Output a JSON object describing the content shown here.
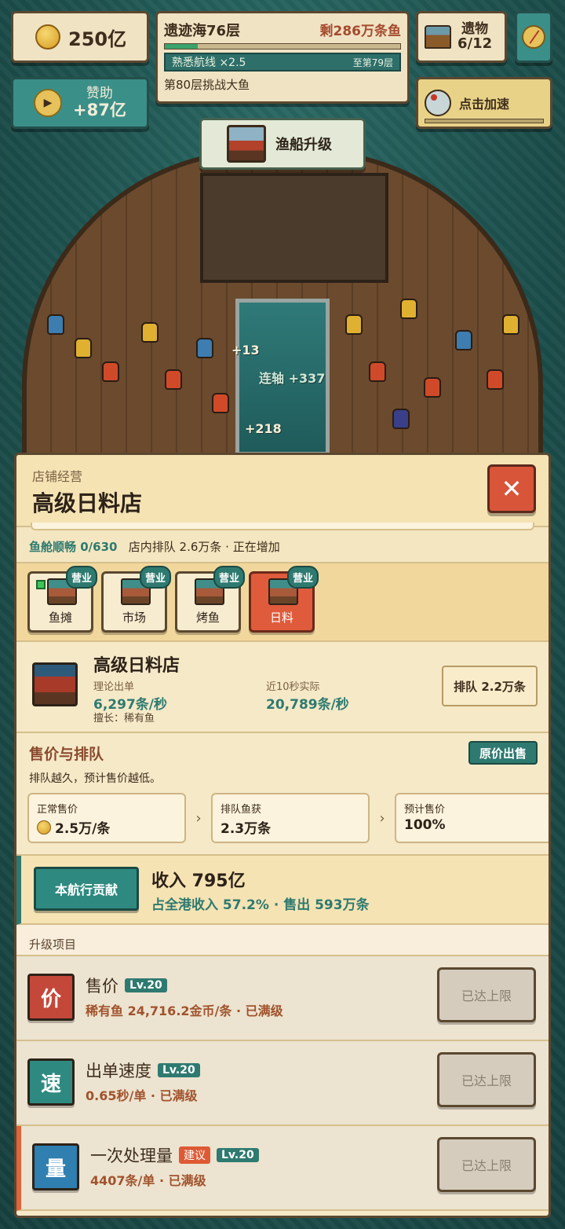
{
  "hud": {
    "coins": "250亿",
    "sponsor": {
      "title": "赞助",
      "amount": "+87亿"
    },
    "level": {
      "title": "遗迹海76层",
      "remaining": "剩286万条鱼",
      "progress": 0.14,
      "route_name": "熟悉航线 ×2.5",
      "route_goal": "至第79层",
      "challenge": "第80层挑战大鱼"
    },
    "relics": {
      "title": "遗物",
      "count": "6/12"
    },
    "boost_label": "点击加速",
    "ship_upgrade_label": "渔船升级"
  },
  "scene": {
    "floats": [
      "+13",
      "连轴 +337",
      "+218"
    ]
  },
  "panel": {
    "subtitle": "店铺经营",
    "title": "高级日料店",
    "close_symbol": "✕",
    "status": {
      "prefix": "鱼舱顺畅 0/630",
      "queue": "店内排队 2.6万条 · 正在增加"
    },
    "tabs": [
      {
        "label": "鱼摊",
        "badge": "营业"
      },
      {
        "label": "市场",
        "badge": "营业"
      },
      {
        "label": "烤鱼",
        "badge": "营业"
      },
      {
        "label": "日料",
        "badge": "营业"
      }
    ],
    "shop": {
      "name": "高级日料店",
      "theory_label": "理论出单",
      "theory_value": "6,297条/秒",
      "actual_label": "近10秒实际",
      "actual_value": "20,789条/秒",
      "skill": "擅长：稀有鱼",
      "queue_btn": "排队 2.2万条"
    },
    "price": {
      "title": "售价与排队",
      "orig_btn": "原价出售",
      "note": "排队越久，预计售价越低。",
      "normal_label": "正常售价",
      "normal_value": "2.5万/条",
      "queued_label": "排队鱼获",
      "queued_value": "2.3万条",
      "expected_label": "预计售价",
      "expected_value": "100%",
      "arrow": "›"
    },
    "income": {
      "button": "本航行贡献",
      "value": "收入 795亿",
      "share": "占全港收入 57.2% · 售出 593万条"
    },
    "upgrades_title": "升级项目",
    "upgrades": [
      {
        "icon_char": "价",
        "icon_color": "#c4483a",
        "name": "售价",
        "level": "Lv.20",
        "suggest": "",
        "desc": "稀有鱼 24,716.2金币/条 · 已满级",
        "button": "已达上限"
      },
      {
        "icon_char": "速",
        "icon_color": "#2e8a80",
        "name": "出单速度",
        "level": "Lv.20",
        "suggest": "",
        "desc": "0.65秒/单 · 已满级",
        "button": "已达上限"
      },
      {
        "icon_char": "量",
        "icon_color": "#2f7fb0",
        "name": "一次处理量",
        "level": "Lv.20",
        "suggest": "建议",
        "desc": "4407条/单 · 已满级",
        "button": "已达上限"
      }
    ]
  }
}
